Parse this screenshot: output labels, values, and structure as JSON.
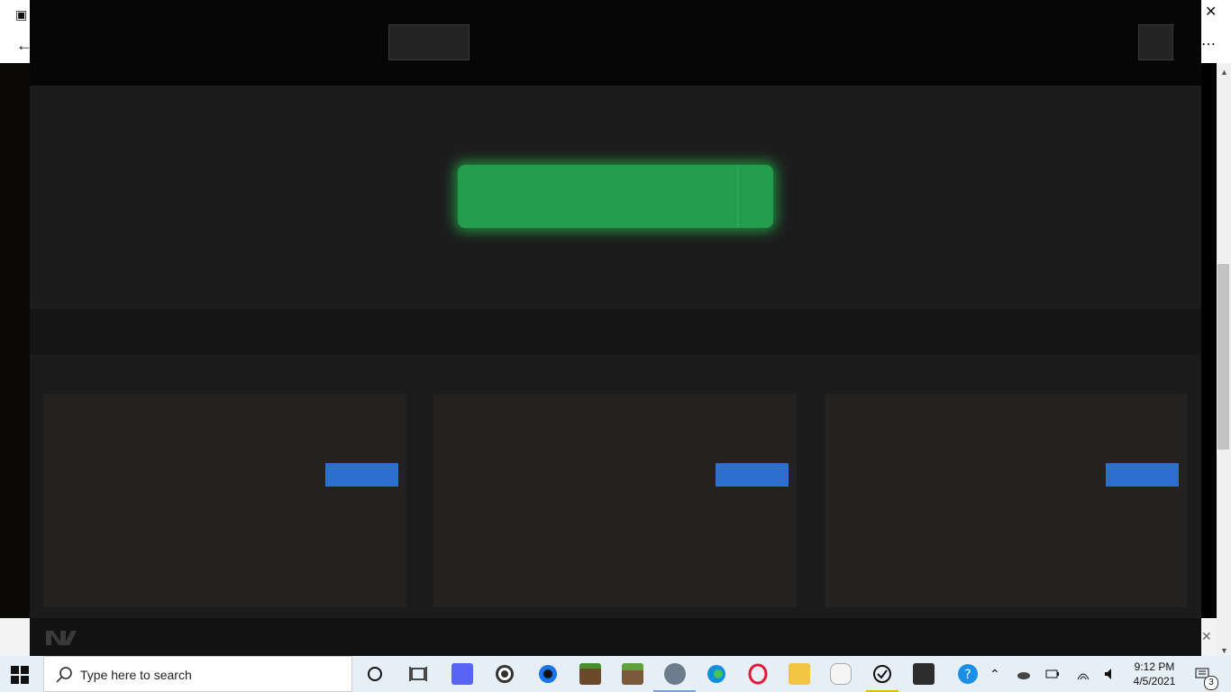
{
  "taskbar": {
    "search_placeholder": "Type here to search",
    "time": "9:12 PM",
    "date": "4/5/2021",
    "notification_count": "3",
    "apps": [
      "cortana-icon",
      "task-view-icon",
      "discord-icon",
      "obs-icon",
      "app-blue-circle-icon",
      "minecraft-icon",
      "minecraft-alt-icon",
      "app-gray-icon",
      "edge-icon",
      "opera-icon",
      "file-explorer-icon",
      "app-mouse-icon",
      "app-check-icon",
      "davinci-icon",
      "help-icon"
    ]
  },
  "colors": {
    "primary_cta": "#239d4d",
    "card_button": "#2c6fcf",
    "page_bg": "#1c1c1c"
  }
}
